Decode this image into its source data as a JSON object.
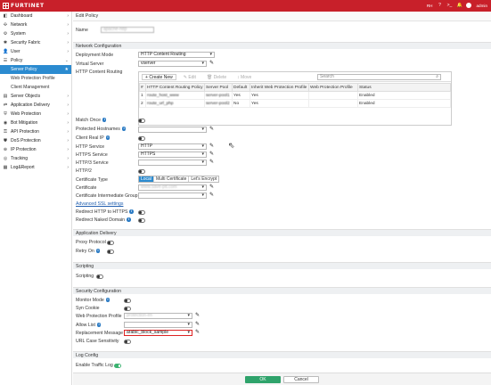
{
  "topbar": {
    "brand": "FURTINET",
    "device_label": "RH",
    "user_label": "admin",
    "colors": {
      "brand_red": "#c8202a",
      "accent_blue": "#2b8bd0",
      "ok_green": "#2fa36b"
    }
  },
  "sidebar": {
    "items": [
      {
        "label": "Dashboard",
        "icon": "dashboard-icon",
        "glyph": "◧",
        "chevron": "›"
      },
      {
        "label": "Network",
        "icon": "network-icon",
        "glyph": "✣",
        "chevron": "›"
      },
      {
        "label": "System",
        "icon": "system-icon",
        "glyph": "⚙",
        "chevron": "›"
      },
      {
        "label": "Security Fabric",
        "icon": "fabric-icon",
        "glyph": "✱",
        "chevron": "›"
      },
      {
        "label": "User",
        "icon": "user-icon",
        "glyph": "👤",
        "chevron": "›"
      },
      {
        "label": "Policy",
        "icon": "policy-icon",
        "glyph": "☰",
        "chevron": "⌄"
      },
      {
        "label": "Server Policy",
        "active": true
      },
      {
        "label": "Web Protection Profile"
      },
      {
        "label": "Client Management"
      },
      {
        "label": "Server Objects",
        "icon": "server-objects-icon",
        "glyph": "▤",
        "chevron": "›"
      },
      {
        "label": "Application Delivery",
        "icon": "app-delivery-icon",
        "glyph": "⇄",
        "chevron": "›"
      },
      {
        "label": "Web Protection",
        "icon": "web-protection-icon",
        "glyph": "⛨",
        "chevron": "›"
      },
      {
        "label": "Bot Mitigation",
        "icon": "bot-icon",
        "glyph": "◉",
        "chevron": "›"
      },
      {
        "label": "API Protection",
        "icon": "api-icon",
        "glyph": "⚿",
        "chevron": "›"
      },
      {
        "label": "DoS Protection",
        "icon": "dos-icon",
        "glyph": "⛊",
        "chevron": "›"
      },
      {
        "label": "IP Protection",
        "icon": "ip-protection-icon",
        "glyph": "⊕",
        "chevron": "›"
      },
      {
        "label": "Tracking",
        "icon": "tracking-icon",
        "glyph": "◎",
        "chevron": "›"
      },
      {
        "label": "Log&Report",
        "icon": "log-report-icon",
        "glyph": "▦",
        "chevron": "›"
      }
    ],
    "star": "★"
  },
  "page": {
    "title": "Edit Policy",
    "name_label": "Name",
    "name_value": "apache-http"
  },
  "network": {
    "section": "Network Configuration",
    "deployment_mode_label": "Deployment Mode",
    "deployment_mode": "HTTP Content Routing",
    "virtual_server_label": "Virtual Server",
    "virtual_server": "vserver",
    "content_routing_label": "HTTP Content Routing",
    "toolbar": {
      "create": "Create New",
      "edit": "Edit",
      "delete": "Delete",
      "move": "Move",
      "search_placeholder": "Search"
    },
    "columns": [
      "#",
      "HTTP Content Routing Policy",
      "Server Pool",
      "Default",
      "Inherit Web Protection Profile",
      "Web Protection Profile",
      "Status"
    ],
    "rows": [
      [
        "1",
        "route_host_www",
        "server-pool1",
        "Yes",
        "Yes",
        "",
        "Enabled"
      ],
      [
        "2",
        "route_url_php",
        "server-pool2",
        "No",
        "Yes",
        "",
        "Enabled"
      ]
    ],
    "match_once_label": "Match Once",
    "protected_hostnames_label": "Protected Hostnames",
    "client_real_ip_label": "Client Real IP",
    "http_service_label": "HTTP Service",
    "http_service": "HTTP",
    "https_service_label": "HTTPS Service",
    "https_service": "HTTPS",
    "http3_service_label": "HTTP/3 Service",
    "http2_label": "HTTP/2",
    "cert_type_label": "Certificate Type",
    "cert_type_options": [
      "Local",
      "Multi Certificate",
      "Let's Encrypt"
    ],
    "certificate_label": "Certificate",
    "certificate": "www.save-ptt.com",
    "cert_inter_label": "Certificate Intermediate Group",
    "advanced_ssl": "Advanced SSL settings",
    "redirect_http_label": "Redirect HTTP to HTTPS",
    "redirect_naked_label": "Redirect Naked Domain"
  },
  "app_delivery": {
    "section": "Application Delivery",
    "proxy_protocol_label": "Proxy Protocol",
    "retry_on_label": "Retry On"
  },
  "scripting": {
    "section": "Scripting",
    "scripting_label": "Scripting"
  },
  "security": {
    "section": "Security Configuration",
    "monitor_mode_label": "Monitor Mode",
    "syn_cookie_label": "Syn Cookie",
    "wpp_label": "Web Protection Profile",
    "wpp_value": "protection-lm",
    "allow_list_label": "Allow List",
    "replacement_label": "Replacement Message",
    "replacement_value": "arabic_block_sample",
    "url_case_label": "URL Case Sensitivity"
  },
  "log": {
    "section": "Log Config",
    "enable_traffic_label": "Enable Traffic Log"
  },
  "footer": {
    "ok": "OK",
    "cancel": "Cancel"
  }
}
